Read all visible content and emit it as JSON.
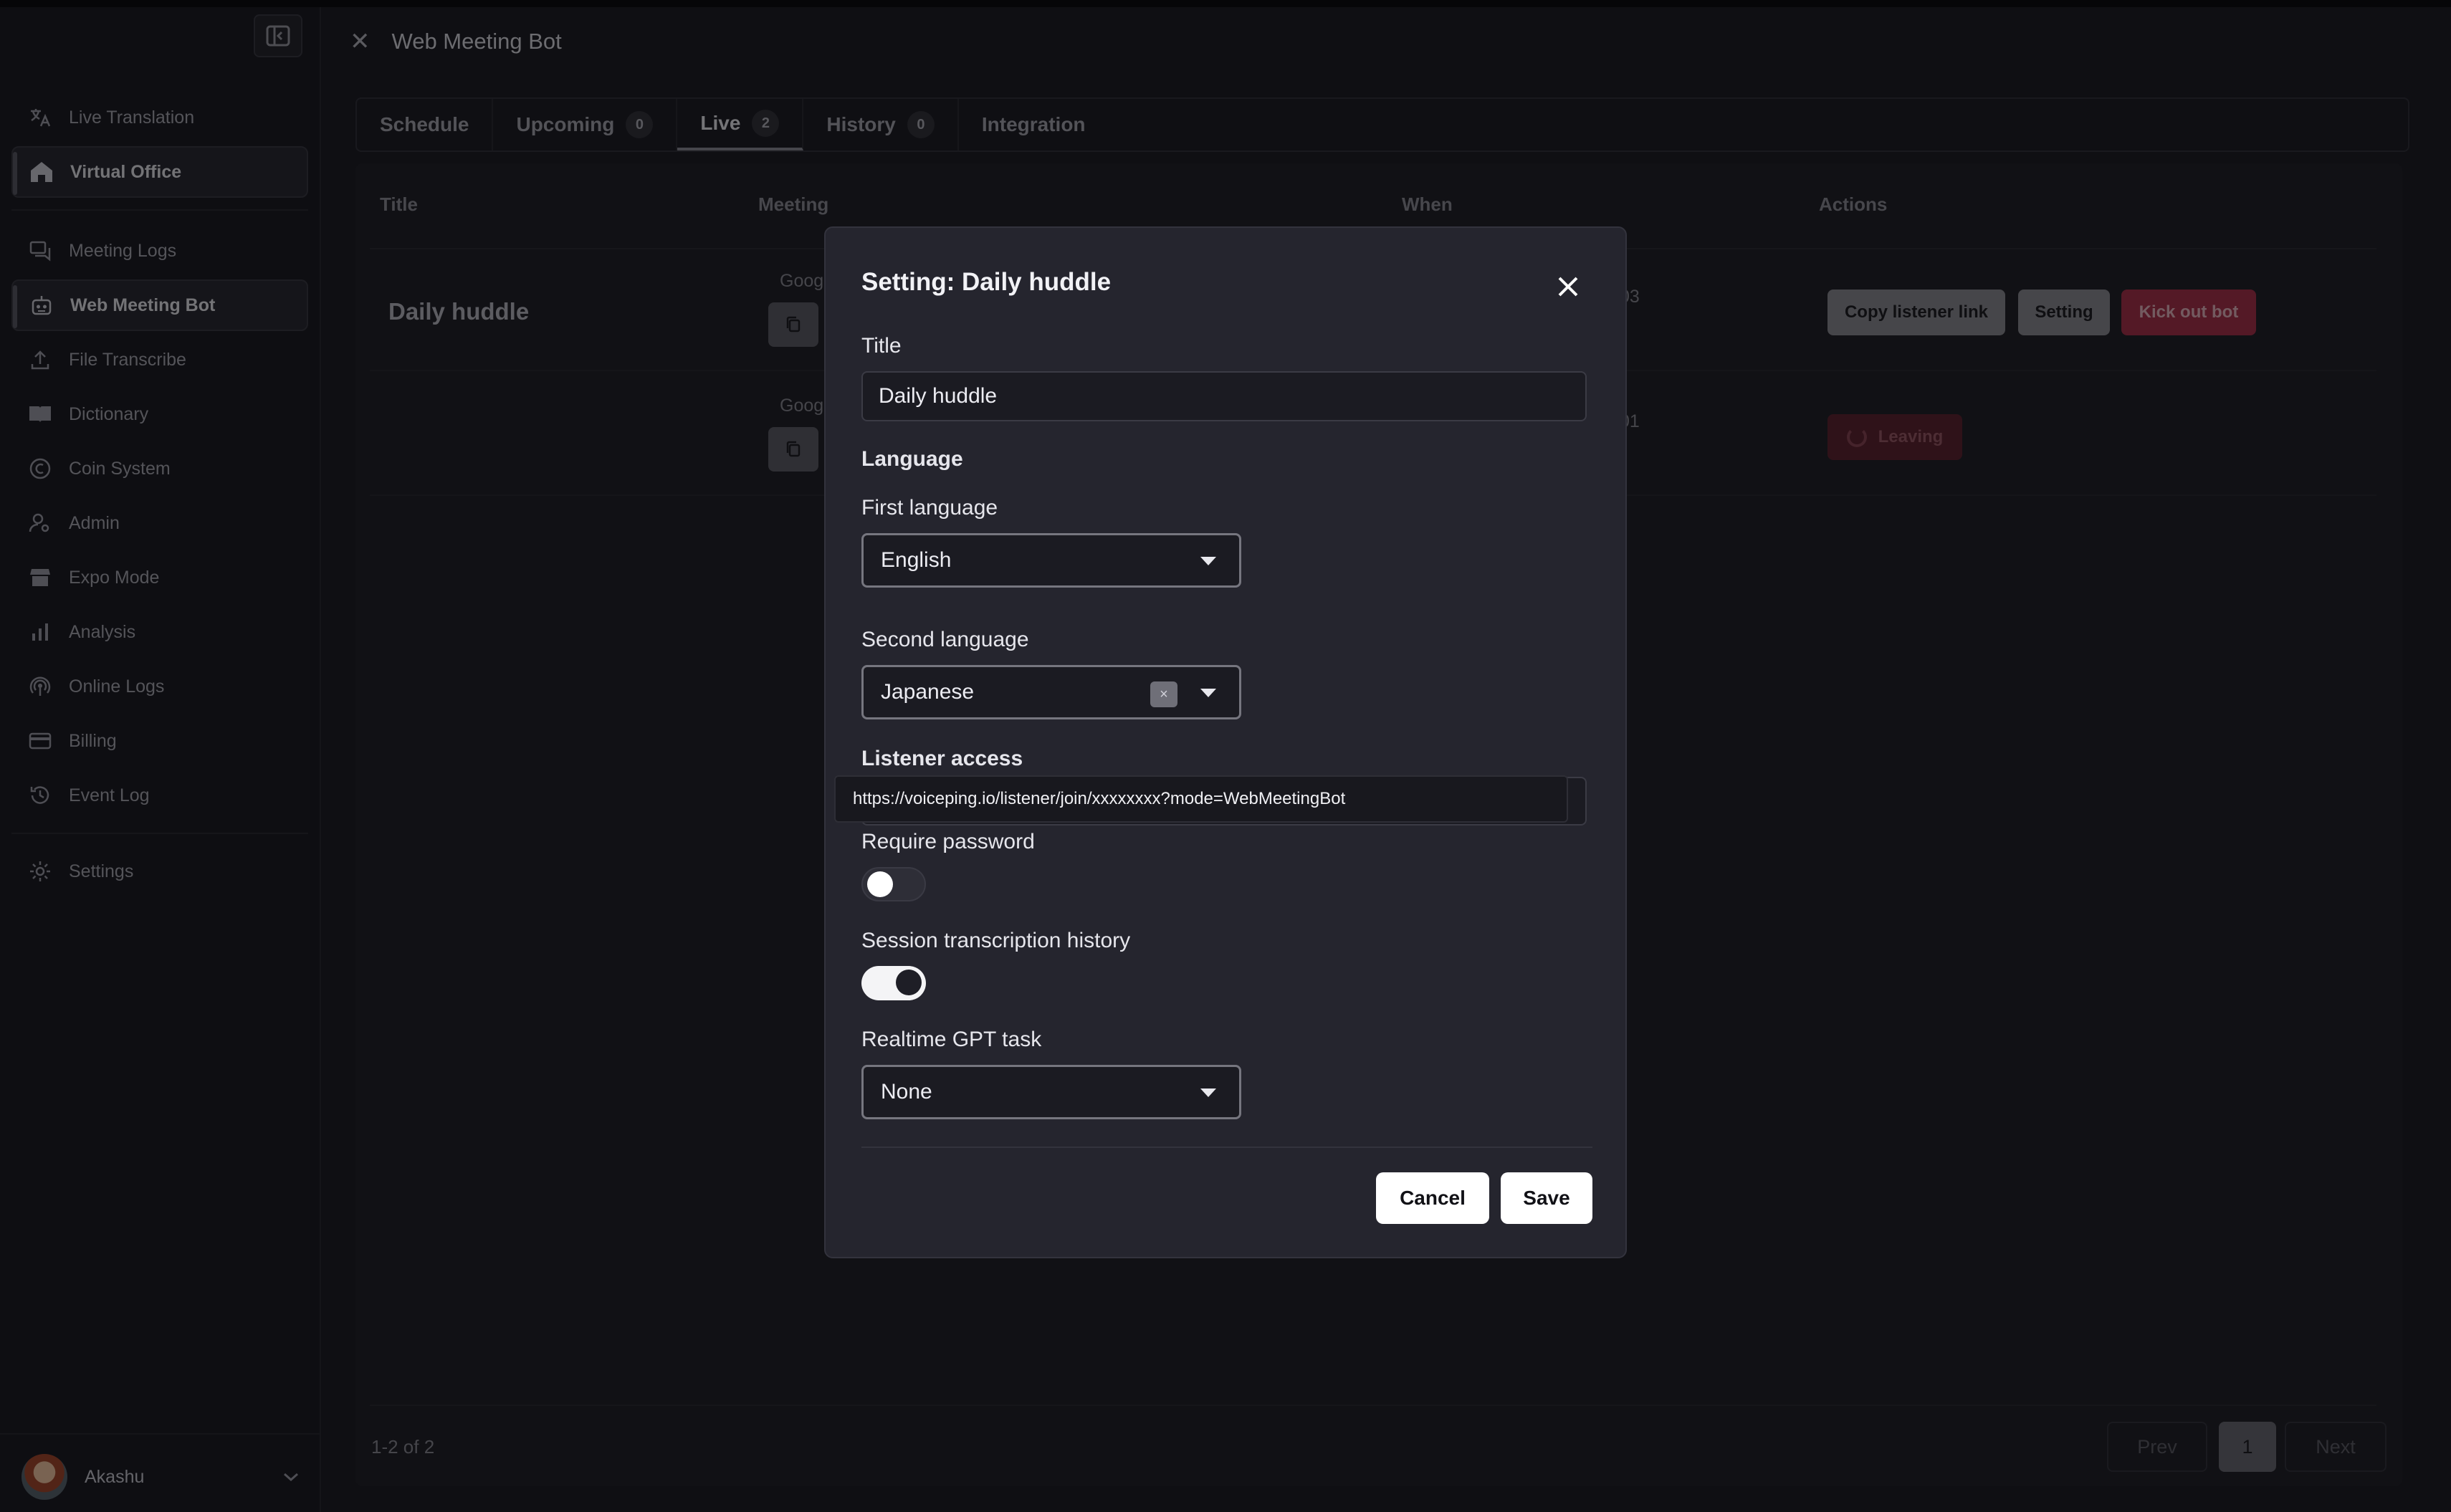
{
  "app": {
    "page_title": "Web Meeting Bot"
  },
  "sidebar": {
    "items": [
      {
        "label": "Live Translation",
        "icon": "translate-icon"
      },
      {
        "label": "Virtual Office",
        "icon": "house-icon",
        "active": true
      },
      {
        "label": "Meeting Logs",
        "icon": "chat-log-icon"
      },
      {
        "label": "Web Meeting Bot",
        "icon": "robot-icon",
        "active": true
      },
      {
        "label": "File Transcribe",
        "icon": "upload-icon"
      },
      {
        "label": "Dictionary",
        "icon": "book-icon"
      },
      {
        "label": "Coin System",
        "icon": "coin-icon"
      },
      {
        "label": "Admin",
        "icon": "admin-user-icon"
      },
      {
        "label": "Expo Mode",
        "icon": "store-icon"
      },
      {
        "label": "Analysis",
        "icon": "bar-chart-icon"
      },
      {
        "label": "Online Logs",
        "icon": "broadcast-icon"
      },
      {
        "label": "Billing",
        "icon": "credit-card-icon"
      },
      {
        "label": "Event Log",
        "icon": "history-icon"
      },
      {
        "label": "Settings",
        "icon": "gear-icon"
      }
    ],
    "user": {
      "name": "Akashu"
    }
  },
  "tabs": [
    {
      "label": "Schedule",
      "count": null
    },
    {
      "label": "Upcoming",
      "count": "0"
    },
    {
      "label": "Live",
      "count": "2",
      "active": true
    },
    {
      "label": "History",
      "count": "0"
    },
    {
      "label": "Integration",
      "count": null
    }
  ],
  "table": {
    "headers": [
      "Title",
      "Meeting",
      "When",
      "Actions"
    ],
    "rows": [
      {
        "title": "Daily huddle",
        "meeting": "Goog",
        "when": "03"
      },
      {
        "title": "",
        "meeting": "Goog",
        "when": "01"
      }
    ],
    "actions": {
      "copy_link": "Copy listener link",
      "setting": "Setting",
      "kick": "Kick out bot",
      "leaving": "Leaving"
    },
    "pagination": {
      "summary": "1-2 of 2",
      "prev": "Prev",
      "page": "1",
      "next": "Next"
    }
  },
  "modal": {
    "title": "Setting: Daily huddle",
    "title_label": "Title",
    "title_value": "Daily huddle",
    "language_heading": "Language",
    "first_language_label": "First language",
    "first_language_value": "English",
    "second_language_label": "Second language",
    "second_language_value": "Japanese",
    "clear_symbol": "×",
    "listener_access_label": "Listener access",
    "listener_url": "https://voiceping.io/listener/join/xxxxxxxx?mode=WebMeetingBot",
    "require_password_label": "Require password",
    "require_password_on": false,
    "session_history_label": "Session transcription history",
    "session_history_on": true,
    "gpt_task_label": "Realtime GPT task",
    "gpt_task_value": "None",
    "cancel": "Cancel",
    "save": "Save"
  }
}
